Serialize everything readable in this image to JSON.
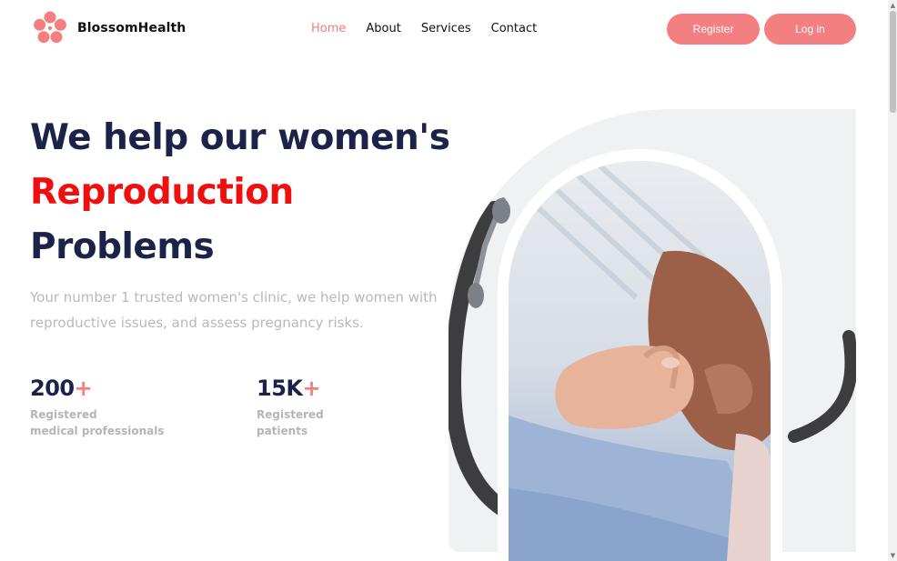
{
  "brand": {
    "name": "BlossomHealth",
    "accent_color": "#f47f80",
    "logo_icon": "flower-icon"
  },
  "nav": {
    "items": [
      {
        "label": "Home",
        "active": true
      },
      {
        "label": "About",
        "active": false
      },
      {
        "label": "Services",
        "active": false
      },
      {
        "label": "Contact",
        "active": false
      }
    ]
  },
  "auth": {
    "register_label": "Register",
    "login_label": "Log in"
  },
  "hero": {
    "title_line1": "We help our women's",
    "title_line2": "Reproduction",
    "title_line3": "Problems",
    "highlight_color": "#f00f0f",
    "subtitle": "Your number 1 trusted women's clinic, we help women with reproductive issues, and assess pregnancy risks."
  },
  "stats": [
    {
      "number": "200",
      "suffix": "+",
      "label_line1": "Registered",
      "label_line2": "medical professionals"
    },
    {
      "number": "15K",
      "suffix": "+",
      "label_line1": "Registered",
      "label_line2": "patients"
    }
  ],
  "hero_image": {
    "subject": "adult-hand-holding-baby-hand-with-stethoscope"
  }
}
